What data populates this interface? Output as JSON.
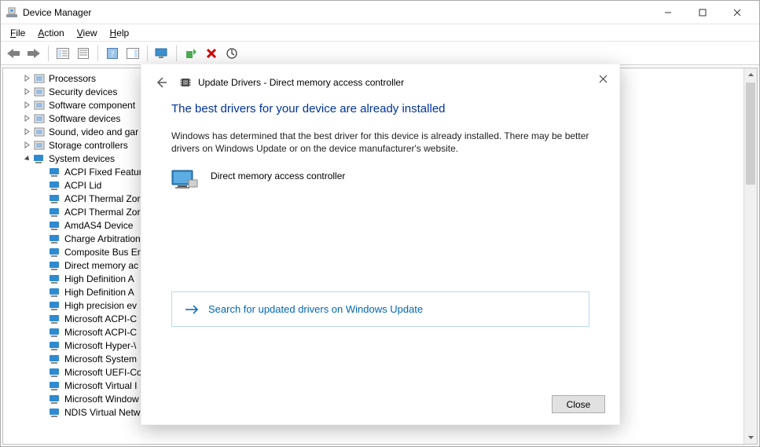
{
  "window": {
    "title": "Device Manager",
    "controls": {
      "min": "minimize",
      "max": "maximize",
      "close": "close"
    }
  },
  "menu": {
    "file": "File",
    "action": "Action",
    "view": "View",
    "help": "Help"
  },
  "toolbar": {
    "back": "back",
    "forward": "forward",
    "show_hide_tree": "show-hide-console-tree",
    "properties": "properties",
    "help": "help",
    "action_menu": "action-menu",
    "monitor": "show-hidden-devices",
    "scan": "scan-for-hardware-changes",
    "uninstall": "uninstall-device",
    "update_driver": "update-driver"
  },
  "tree": {
    "top": [
      {
        "label": "Processors",
        "icon": "processor-icon"
      },
      {
        "label": "Security devices",
        "icon": "security-icon"
      },
      {
        "label": "Software component",
        "icon": "software-component-icon"
      },
      {
        "label": "Software devices",
        "icon": "software-device-icon"
      },
      {
        "label": "Sound, video and gar",
        "icon": "sound-icon"
      },
      {
        "label": "Storage controllers",
        "icon": "storage-icon"
      }
    ],
    "expanded": {
      "label": "System devices",
      "icon": "system-devices-icon"
    },
    "children": [
      "ACPI Fixed Featur",
      "ACPI Lid",
      "ACPI Thermal Zor",
      "ACPI Thermal Zor",
      "AmdAS4 Device",
      "Charge Arbitration",
      "Composite Bus Er",
      "Direct memory ac",
      "High Definition A",
      "High Definition A",
      "High precision ev",
      "Microsoft ACPI-C",
      "Microsoft ACPI-C",
      "Microsoft Hyper-\\",
      "Microsoft System",
      "Microsoft UEFI-Co",
      "Microsoft Virtual I",
      "Microsoft Window",
      "NDIS Virtual Network Adapter Enumerator"
    ]
  },
  "dialog": {
    "title": "Update Drivers - Direct memory access controller",
    "heading": "The best drivers for your device are already installed",
    "paragraph": "Windows has determined that the best driver for this device is already installed. There may be better drivers on Windows Update or on the device manufacturer's website.",
    "device_name": "Direct memory access controller",
    "link": "Search for updated drivers on Windows Update",
    "close": "Close"
  }
}
